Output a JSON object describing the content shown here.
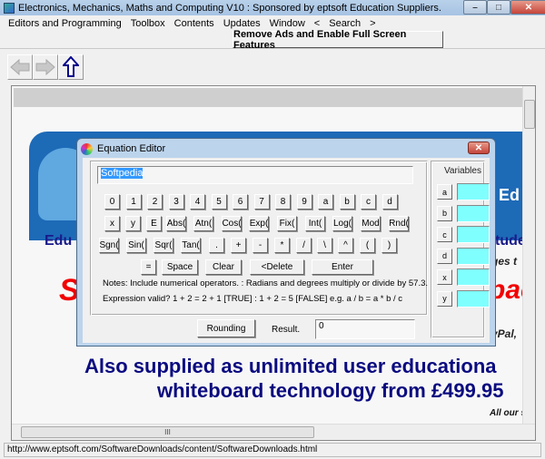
{
  "window": {
    "title": "Electronics, Mechanics, Maths and Computing V10 : Sponsored by eptsoft Education Suppliers.",
    "minimize": "–",
    "maximize": "□",
    "close": "✕"
  },
  "menubar": {
    "items": [
      "Editors and Programming",
      "Toolbox",
      "Contents",
      "Updates",
      "Window",
      "<",
      "Search",
      ">"
    ]
  },
  "toolbar": {
    "remove_ads_label": "Remove Ads and Enable Full Screen Features"
  },
  "nav": {
    "back_icon": "back-arrow-icon",
    "forward_icon": "forward-arrow-icon",
    "up_icon": "up-arrow-icon"
  },
  "page": {
    "banner_text": "cs Ed",
    "line_edu_left": "Edu",
    "line_edu_right": "tude",
    "line_ages": "ges t",
    "red_left": "S",
    "red_right": "pac",
    "paypal": "yPal,",
    "also_line1": "Also supplied as unlimited user educationa",
    "also_line2": "whiteboard technology from £499.95",
    "all_our": "All our s",
    "hscroll_grip": "III"
  },
  "statusbar": {
    "url": "http://www.eptsoft.com/SoftwareDownloads/content/SoftwareDownloads.html"
  },
  "dialog": {
    "title": "Equation Editor",
    "close": "✕",
    "expression_value": "Softpedia",
    "keys_row1": [
      "0",
      "1",
      "2",
      "3",
      "4",
      "5",
      "6",
      "7",
      "8",
      "9",
      "a",
      "b",
      "c",
      "d"
    ],
    "keys_row2": [
      "x",
      "y",
      "E",
      "Abs(",
      "Atn(",
      "Cos(",
      "Exp(",
      "Fix(",
      "Int(",
      "Log(",
      "Mod",
      "Rnd("
    ],
    "keys_row3": [
      "Sgn(",
      "Sin(",
      "Sqr(",
      "Tan(",
      ".",
      "+",
      "-",
      "*",
      "/",
      "\\",
      "^",
      "(",
      ")"
    ],
    "keys_row4": [
      "=",
      "Space",
      "Clear",
      "<Delete",
      "Enter"
    ],
    "notes": "Notes:  Include numerical operators. :  Radians and degrees multiply or divide by 57.3.",
    "valid": "Expression valid?     1 + 2 = 2 + 1 [TRUE] : 1 + 2 = 5 [FALSE]     e.g. a / b = a * b / c",
    "rounding_label": "Rounding",
    "result_label": "Result.",
    "result_value": "0",
    "variables_label": "Variables",
    "variables": [
      {
        "name": "a",
        "value": ""
      },
      {
        "name": "b",
        "value": ""
      },
      {
        "name": "c",
        "value": ""
      },
      {
        "name": "d",
        "value": ""
      },
      {
        "name": "x",
        "value": ""
      },
      {
        "name": "y",
        "value": ""
      }
    ]
  }
}
